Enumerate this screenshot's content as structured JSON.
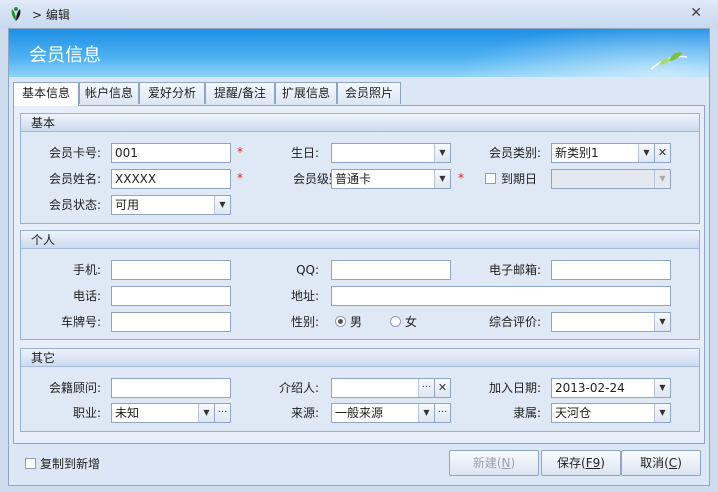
{
  "window": {
    "title": "> 编辑",
    "close": "✕"
  },
  "banner": {
    "title": "会员信息"
  },
  "tabs": [
    "基本信息",
    "帐户信息",
    "爱好分析",
    "提醒/备注",
    "扩展信息",
    "会员照片"
  ],
  "groups": {
    "basic": {
      "title": "基本",
      "card_label": "会员卡号:",
      "card_value": "001",
      "birthday_label": "生日:",
      "birthday_value": "",
      "category_label": "会员类别:",
      "category_value": "新类别1",
      "name_label": "会员姓名:",
      "name_value": "XXXXX",
      "level_label": "会员级别:",
      "level_value": "普通卡",
      "expiry_label": "到期日",
      "expiry_value": "",
      "status_label": "会员状态:",
      "status_value": "可用",
      "required_mark": "*"
    },
    "personal": {
      "title": "个人",
      "mobile_label": "手机:",
      "mobile_value": "",
      "qq_label": "QQ:",
      "qq_value": "",
      "email_label": "电子邮箱:",
      "email_value": "",
      "phone_label": "电话:",
      "phone_value": "",
      "address_label": "地址:",
      "address_value": "",
      "plate_label": "车牌号:",
      "plate_value": "",
      "gender_label": "性别:",
      "gender_male": "男",
      "gender_female": "女",
      "rating_label": "综合评价:",
      "rating_value": ""
    },
    "other": {
      "title": "其它",
      "advisor_label": "会籍顾问:",
      "advisor_value": "",
      "referrer_label": "介绍人:",
      "referrer_value": "",
      "joindate_label": "加入日期:",
      "joindate_value": "2013-02-24",
      "job_label": "职业:",
      "job_value": "未知",
      "source_label": "来源:",
      "source_value": "一般来源",
      "belong_label": "隶属:",
      "belong_value": "天河仓"
    }
  },
  "footer": {
    "copy_label": "复制到新增",
    "new_label": "新建(",
    "new_key": "N",
    "new_tail": ")",
    "save_label": "保存(",
    "save_key": "F9",
    "save_tail": ")",
    "cancel_label": "取消(",
    "cancel_key": "C",
    "cancel_tail": ")"
  },
  "icons": {
    "dropdown": "▼",
    "ellipsis": "···",
    "clear": "✕"
  }
}
